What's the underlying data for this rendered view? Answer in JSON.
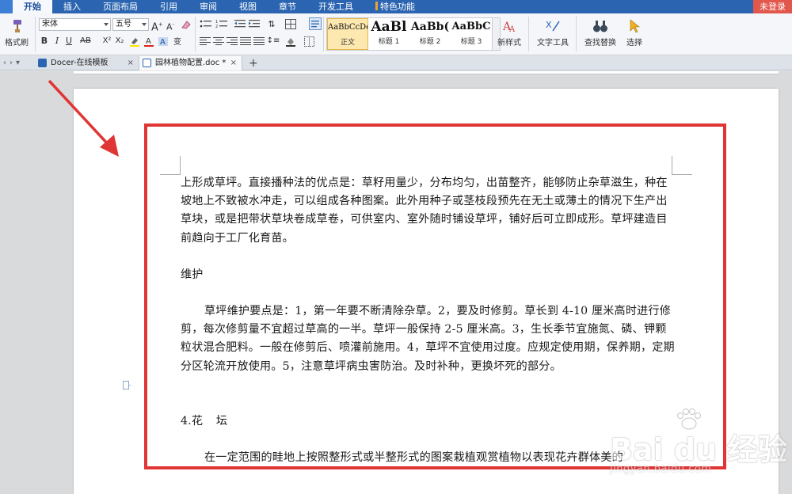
{
  "menubar": {
    "tabs": [
      "开始",
      "插入",
      "页面布局",
      "引用",
      "审阅",
      "视图",
      "章节",
      "开发工具",
      "特色功能"
    ],
    "active_tab": "开始",
    "login": "未登录"
  },
  "ribbon": {
    "format_painter": "格式刷",
    "font_family": "宋体",
    "font_size": "五号",
    "styles": [
      {
        "sample": "AaBbCcDd",
        "name": "正文"
      },
      {
        "sample": "AaBl",
        "name": "标题 1"
      },
      {
        "sample": "AaBb(",
        "name": "标题 2"
      },
      {
        "sample": "AaBbC",
        "name": "标题 3"
      }
    ],
    "new_style": "新样式",
    "text_tools": "文字工具",
    "find_replace": "查找替换",
    "select": "选择"
  },
  "doc_tabs": [
    {
      "label": "Docer-在线模板",
      "close": "×"
    },
    {
      "label": "园林植物配置.doc *",
      "close": "×"
    }
  ],
  "document": {
    "para1": "上形成草坪。直接播种法的优点是：草籽用量少，分布均匀，出苗整齐，能够防止杂草滋生，种在坡地上不致被水冲走，可以组成各种图案。此外用种子或茎枝段预先在无土或薄土的情况下生产出草块，或是把带状草块卷成草卷，可供室内、室外随时铺设草坪，铺好后可立即成形。草坪建造目前趋向于工厂化育苗。",
    "heading_maintain": "维护",
    "para2": "草坪维护要点是：1，第一年要不断清除杂草。2，要及时修剪。草长到 4-10 厘米高时进行修剪，每次修剪量不宜超过草高的一半。草坪一般保持 2-5 厘米高。3，生长季节宜施氮、磷、钾颗粒状混合肥料。一般在修剪后、喷灌前施用。4，草坪不宜使用过度。应规定使用期，保养期，定期分区轮流开放使用。5，注意草坪病虫害防治。及时补种，更换坏死的部分。",
    "heading_flowerbed": "4.花 坛",
    "para3": "在一定范围的畦地上按照整形式或半整形式的图案栽植观赏植物以表现花卉群体美的"
  },
  "watermark": {
    "brand": "Bai du 经验",
    "url": "jingyan.baidu.com"
  },
  "colors": {
    "menubar": "#2b65b1",
    "highlight_box": "#e03535",
    "arrow": "#e03535"
  }
}
